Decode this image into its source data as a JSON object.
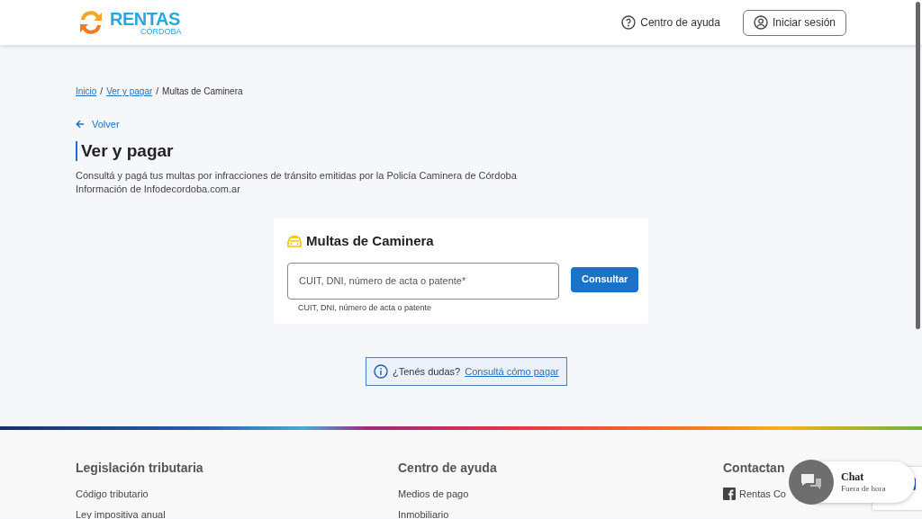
{
  "header": {
    "logo_title": "RENTAS",
    "logo_subtitle": "CÓRDOBA",
    "help_link": "Centro de ayuda",
    "login_button": "Iniciar sesión"
  },
  "breadcrumb": [
    {
      "label": "Inicio",
      "link": true
    },
    {
      "label": "Ver y pagar",
      "link": true
    },
    {
      "label": "Multas de Caminera",
      "link": false
    }
  ],
  "breadcrumb_separators": [
    "/",
    "/"
  ],
  "back_link": "Volver",
  "page_title": "Ver y pagar",
  "description": [
    "Consultá y pagá tus multas por infracciones de tránsito emitidas por la Policía Caminera de Córdoba",
    "Información de Infodecordoba.com.ar"
  ],
  "card": {
    "title": "Multas de Caminera",
    "field": {
      "placeholder": "CUIT, DNI, número de acta o patente",
      "required": true,
      "required_mark": "*",
      "helper": "CUIT, DNI, número de acta o patente"
    },
    "button": "Consultar"
  },
  "info": {
    "text": "¿Tenés dudas?",
    "link": "Consultá cómo pagar"
  },
  "footer": {
    "columns": [
      {
        "title": "Legislación tributaria",
        "links": [
          "Código tributario",
          "Ley impositiva anual"
        ]
      },
      {
        "title": "Centro de ayuda",
        "links": [
          "Medios de pago",
          "Inmobiliario"
        ]
      },
      {
        "title": "Contactan",
        "links": [
          "Rentas Co"
        ]
      }
    ]
  },
  "chat": {
    "title": "Chat",
    "status": "Fuera de hora"
  }
}
